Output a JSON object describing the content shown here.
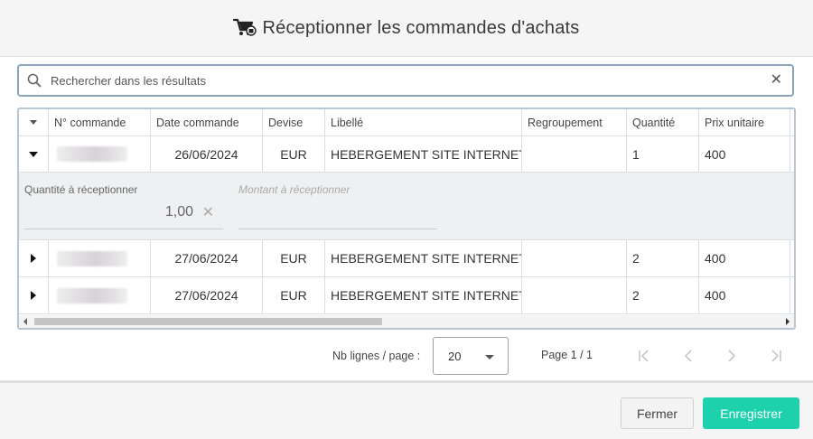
{
  "dialog": {
    "title": "Réceptionner les commandes d'achats",
    "title_icon": "cart-icon"
  },
  "search": {
    "placeholder": "Rechercher dans les résultats",
    "value": "",
    "clear_icon": "close-icon"
  },
  "grid": {
    "columns": [
      "N° commande",
      "Date commande",
      "Devise",
      "Libellé",
      "Regroupement",
      "Quantité",
      "Prix unitaire"
    ],
    "rows": [
      {
        "expanded": true,
        "order_number": "",
        "date": "26/06/2024",
        "currency": "EUR",
        "label": "HEBERGEMENT SITE INTERNET",
        "grouping": "",
        "quantity": "1",
        "unit_price": "400"
      },
      {
        "expanded": false,
        "order_number": "",
        "date": "27/06/2024",
        "currency": "EUR",
        "label": "HEBERGEMENT SITE INTERNET",
        "grouping": "",
        "quantity": "2",
        "unit_price": "400"
      },
      {
        "expanded": false,
        "order_number": "",
        "date": "27/06/2024",
        "currency": "EUR",
        "label": "HEBERGEMENT SITE INTERNET",
        "grouping": "",
        "quantity": "2",
        "unit_price": "400"
      }
    ],
    "detail": {
      "qty_label": "Quantité à réceptionner",
      "qty_value": "1,00",
      "amount_label": "Montant à réceptionner",
      "amount_value": ""
    }
  },
  "pager": {
    "rows_per_page_label": "Nb lignes / page :",
    "rows_per_page": "20",
    "page_info": "Page 1 / 1"
  },
  "footer": {
    "close_label": "Fermer",
    "save_label": "Enregistrer"
  },
  "colors": {
    "accent": "#1ed1ad",
    "search_border": "#8aa4bd",
    "grid_border": "#b6c6d5"
  }
}
